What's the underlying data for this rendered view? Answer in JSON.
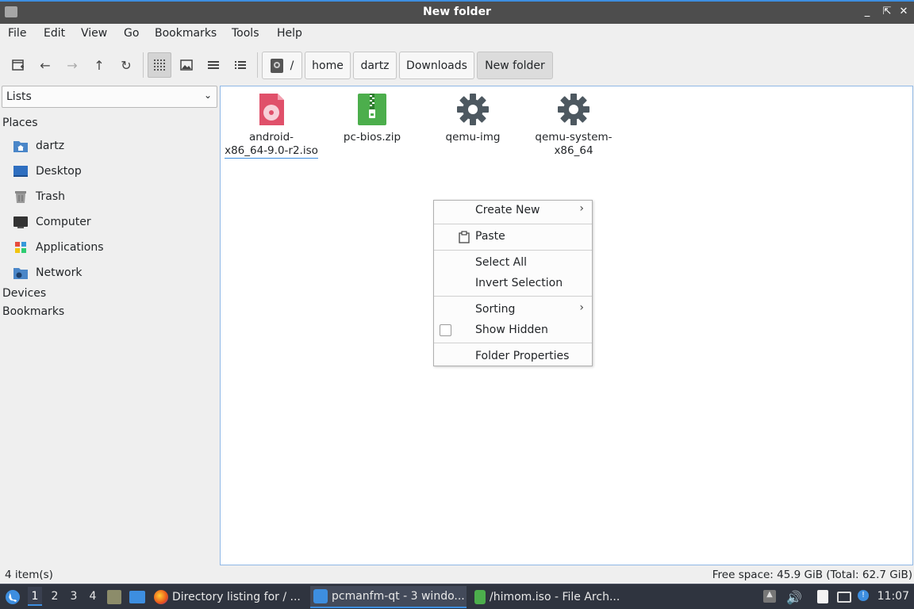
{
  "window": {
    "title": "New folder"
  },
  "menubar": [
    "File",
    "Edit",
    "View",
    "Go",
    "Bookmarks",
    "Tools",
    "Help"
  ],
  "toolbar": {
    "breadcrumbs": [
      "/",
      "home",
      "dartz",
      "Downloads",
      "New folder"
    ]
  },
  "sidebar": {
    "view_select": "Lists",
    "places_header": "Places",
    "places": [
      {
        "label": "dartz",
        "icon": "home-folder-icon"
      },
      {
        "label": "Desktop",
        "icon": "desktop-icon"
      },
      {
        "label": "Trash",
        "icon": "trash-icon"
      },
      {
        "label": "Computer",
        "icon": "computer-icon"
      },
      {
        "label": "Applications",
        "icon": "applications-icon"
      },
      {
        "label": "Network",
        "icon": "network-icon"
      }
    ],
    "devices_header": "Devices",
    "bookmarks_header": "Bookmarks"
  },
  "files": [
    {
      "name": "android-x86_64-9.0-r2.iso",
      "line1": "android-",
      "line2": "x86_64-9.0-r2.iso",
      "icon": "disc-image-icon"
    },
    {
      "name": "pc-bios.zip",
      "line1": "pc-bios.zip",
      "line2": "",
      "icon": "zip-archive-icon"
    },
    {
      "name": "qemu-img",
      "line1": "qemu-img",
      "line2": "",
      "icon": "gear-icon"
    },
    {
      "name": "qemu-system-x86_64",
      "line1": "qemu-system-",
      "line2": "x86_64",
      "icon": "gear-icon"
    }
  ],
  "context_menu": {
    "create_new": "Create New",
    "paste": "Paste",
    "select_all": "Select All",
    "invert_selection": "Invert Selection",
    "sorting": "Sorting",
    "show_hidden": "Show Hidden",
    "folder_properties": "Folder Properties"
  },
  "statusbar": {
    "items": "4 item(s)",
    "free_space": "Free space: 45.9 GiB (Total: 62.7 GiB)"
  },
  "taskbar": {
    "workspaces": [
      "1",
      "2",
      "3",
      "4"
    ],
    "tasks": [
      {
        "label": "Directory listing for / ...",
        "icon": "firefox-icon"
      },
      {
        "label": "pcmanfm-qt - 3 windo...",
        "icon": "folder-icon"
      },
      {
        "label": "/himom.iso - File Arch...",
        "icon": "archive-icon"
      }
    ],
    "clock": "11:07"
  },
  "colors": {
    "accent": "#3d8ee0",
    "titlebar": "#4d4d4d",
    "taskbar": "#2f343f"
  }
}
